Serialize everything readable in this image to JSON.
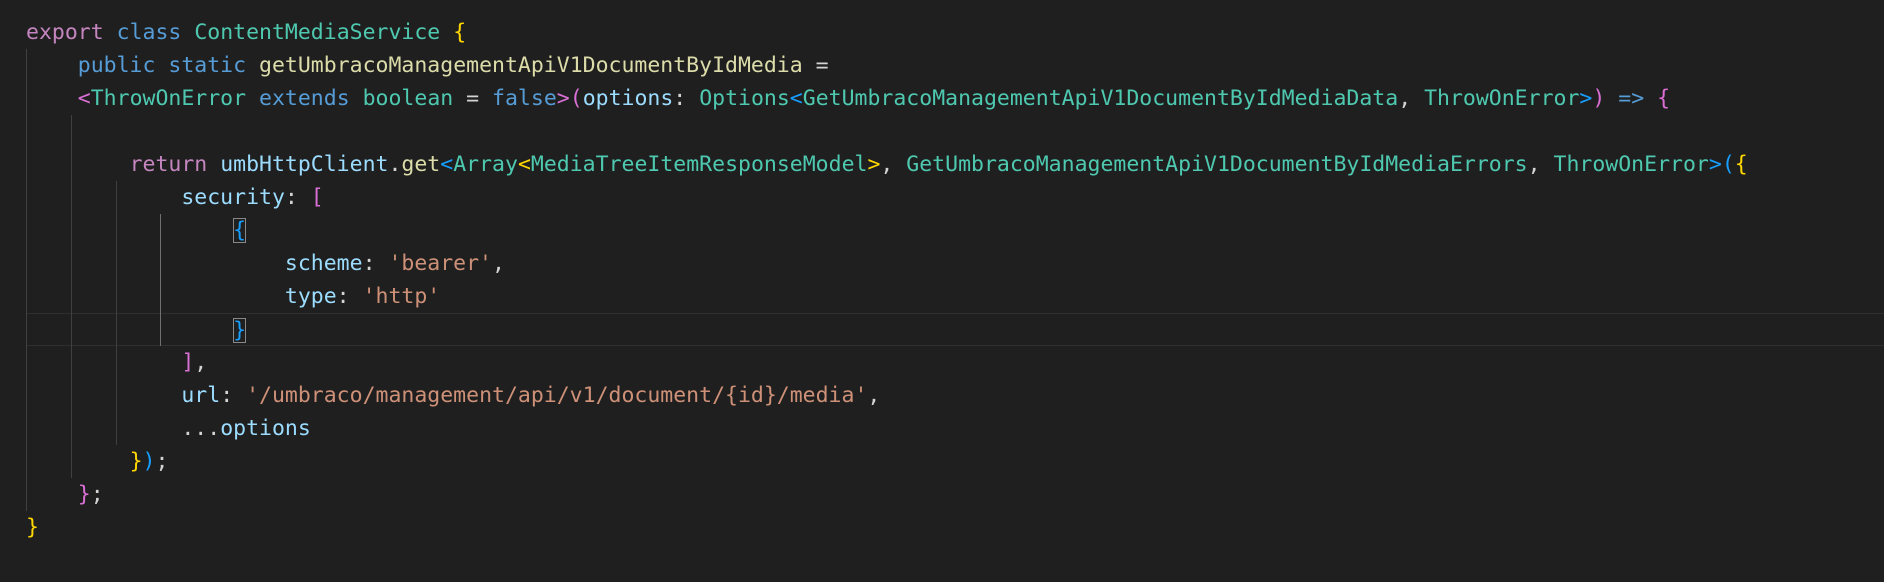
{
  "editor": {
    "background": "#1f1f1f",
    "language": "typescript",
    "theme_colors": {
      "keyword": "#569cd6",
      "control": "#c586c0",
      "type": "#4ec9b0",
      "function": "#dcdcaa",
      "variable": "#9cdcfe",
      "string": "#ce9178",
      "bracket_level_1": "#ffd700",
      "bracket_level_2": "#da70d6",
      "bracket_level_3": "#179fff"
    },
    "cursor_line": 10,
    "lines": [
      {
        "tokens": [
          {
            "t": "export",
            "c": "ctl"
          },
          {
            "t": " "
          },
          {
            "t": "class",
            "c": "kw"
          },
          {
            "t": " "
          },
          {
            "t": "ContentMediaService",
            "c": "typ"
          },
          {
            "t": " "
          },
          {
            "t": "{",
            "c": "br1"
          }
        ]
      },
      {
        "tokens": [
          {
            "t": "    "
          },
          {
            "t": "public",
            "c": "kw"
          },
          {
            "t": " "
          },
          {
            "t": "static",
            "c": "kw"
          },
          {
            "t": " "
          },
          {
            "t": "getUmbracoManagementApiV1DocumentByIdMedia",
            "c": "fn"
          },
          {
            "t": " = "
          }
        ]
      },
      {
        "tokens": [
          {
            "t": "    "
          },
          {
            "t": "<",
            "c": "br2"
          },
          {
            "t": "ThrowOnError",
            "c": "typ"
          },
          {
            "t": " "
          },
          {
            "t": "extends",
            "c": "kw"
          },
          {
            "t": " "
          },
          {
            "t": "boolean",
            "c": "typ"
          },
          {
            "t": " = "
          },
          {
            "t": "false",
            "c": "kw"
          },
          {
            "t": ">",
            "c": "br2"
          },
          {
            "t": "(",
            "c": "br2"
          },
          {
            "t": "options",
            "c": "var"
          },
          {
            "t": ": "
          },
          {
            "t": "Options",
            "c": "typ"
          },
          {
            "t": "<",
            "c": "br3"
          },
          {
            "t": "GetUmbracoManagementApiV1DocumentByIdMediaData",
            "c": "typ"
          },
          {
            "t": ", "
          },
          {
            "t": "ThrowOnError",
            "c": "typ"
          },
          {
            "t": ">",
            "c": "br3"
          },
          {
            "t": ")",
            "c": "br2"
          },
          {
            "t": " "
          },
          {
            "t": "=>",
            "c": "kw"
          },
          {
            "t": " "
          },
          {
            "t": "{",
            "c": "br2"
          }
        ]
      },
      {
        "tokens": []
      },
      {
        "tokens": [
          {
            "t": "        "
          },
          {
            "t": "return",
            "c": "ctl"
          },
          {
            "t": " "
          },
          {
            "t": "umbHttpClient",
            "c": "var"
          },
          {
            "t": "."
          },
          {
            "t": "get",
            "c": "fn"
          },
          {
            "t": "<",
            "c": "br3"
          },
          {
            "t": "Array",
            "c": "typ"
          },
          {
            "t": "<",
            "c": "br1"
          },
          {
            "t": "MediaTreeItemResponseModel",
            "c": "typ"
          },
          {
            "t": ">",
            "c": "br1"
          },
          {
            "t": ", "
          },
          {
            "t": "GetUmbracoManagementApiV1DocumentByIdMediaErrors",
            "c": "typ"
          },
          {
            "t": ", "
          },
          {
            "t": "ThrowOnError",
            "c": "typ"
          },
          {
            "t": ">",
            "c": "br3"
          },
          {
            "t": "(",
            "c": "br3"
          },
          {
            "t": "{",
            "c": "br1"
          }
        ]
      },
      {
        "tokens": [
          {
            "t": "            "
          },
          {
            "t": "security",
            "c": "var"
          },
          {
            "t": ": "
          },
          {
            "t": "[",
            "c": "br2"
          }
        ]
      },
      {
        "tokens": [
          {
            "t": "                "
          },
          {
            "t": "{",
            "c": "br3",
            "match": true
          }
        ]
      },
      {
        "tokens": [
          {
            "t": "                    "
          },
          {
            "t": "scheme",
            "c": "var"
          },
          {
            "t": ": "
          },
          {
            "t": "'bearer'",
            "c": "str"
          },
          {
            "t": ","
          }
        ]
      },
      {
        "tokens": [
          {
            "t": "                    "
          },
          {
            "t": "type",
            "c": "var"
          },
          {
            "t": ": "
          },
          {
            "t": "'http'",
            "c": "str"
          }
        ]
      },
      {
        "tokens": [
          {
            "t": "                "
          },
          {
            "t": "}",
            "c": "br3",
            "match": true
          }
        ]
      },
      {
        "tokens": [
          {
            "t": "            "
          },
          {
            "t": "]",
            "c": "br2"
          },
          {
            "t": ","
          }
        ]
      },
      {
        "tokens": [
          {
            "t": "            "
          },
          {
            "t": "url",
            "c": "var"
          },
          {
            "t": ": "
          },
          {
            "t": "'/umbraco/management/api/v1/document/{id}/media'",
            "c": "str"
          },
          {
            "t": ","
          }
        ]
      },
      {
        "tokens": [
          {
            "t": "            "
          },
          {
            "t": "..."
          },
          {
            "t": "options",
            "c": "var"
          }
        ]
      },
      {
        "tokens": [
          {
            "t": "        "
          },
          {
            "t": "}",
            "c": "br1"
          },
          {
            "t": ")",
            "c": "br3"
          },
          {
            "t": ";"
          }
        ]
      },
      {
        "tokens": [
          {
            "t": "    "
          },
          {
            "t": "}",
            "c": "br2"
          },
          {
            "t": ";"
          }
        ]
      },
      {
        "tokens": [
          {
            "t": "}",
            "c": "br1"
          }
        ]
      }
    ]
  }
}
